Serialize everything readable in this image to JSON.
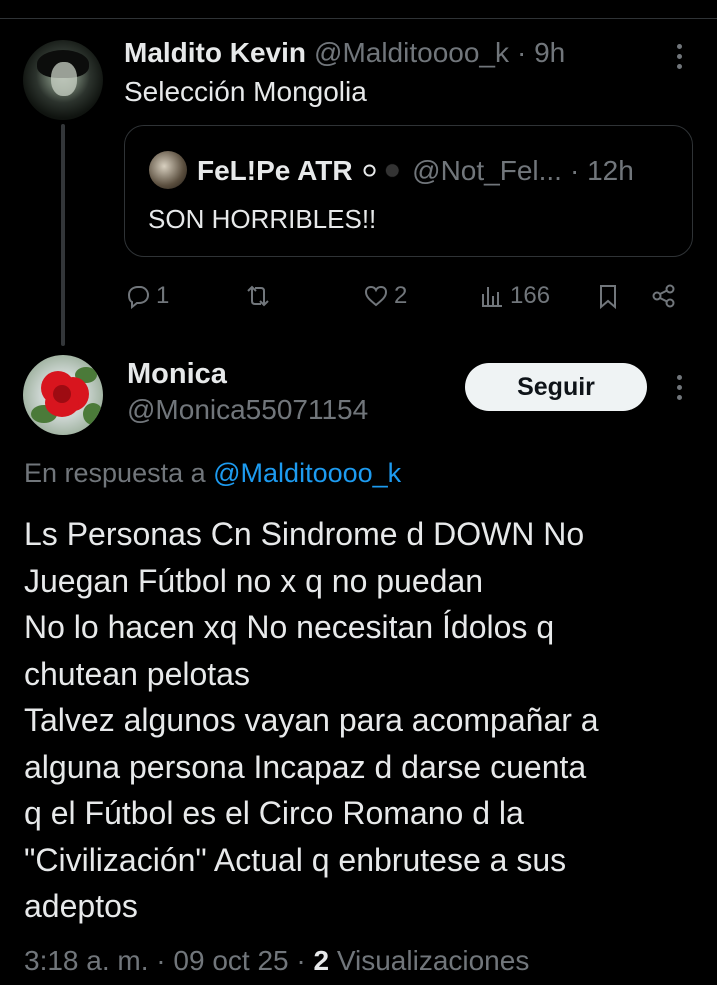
{
  "parent_tweet": {
    "name": "Maldito Kevin",
    "handle": "@Malditoooo_k",
    "time": "· 9h",
    "text": "Selección Mongolia",
    "quote": {
      "name": "FeL!Pe ATR",
      "emoji": "⚪",
      "emoji2": "⚫",
      "handle": "@Not_Fel...",
      "time": "· 12h",
      "text": "SON HORRIBLES!!"
    },
    "actions": {
      "replies": "1",
      "retweets": "",
      "likes": "2",
      "views": "166"
    }
  },
  "reply_tweet": {
    "name": "Monica",
    "handle": "@Monica55071154",
    "follow_label": "Seguir",
    "reply_prefix": "En respuesta a",
    "reply_mention": "@Malditoooo_k",
    "lines": [
      "Ls Personas Cn Sindrome d DOWN No",
      "Juegan Fútbol no x q no puedan",
      "No lo hacen xq No necesitan Ídolos q",
      "chutean pelotas",
      "Talvez algunos vayan para acompañar a",
      "alguna persona Incapaz d darse cuenta",
      "q el Fútbol es el Circo Romano d la",
      "\"Civilización\" Actual q enbrutese a sus",
      "adeptos"
    ],
    "timestamp": "3:18 a. m. · 09 oct 25 ·",
    "views_count": "2",
    "views_label": "Visualizaciones"
  },
  "colors": {
    "background": "#000000",
    "text": "#e7e9ea",
    "muted": "#71767b",
    "link": "#1d9bf0",
    "follow_button": "#eff3f4"
  }
}
